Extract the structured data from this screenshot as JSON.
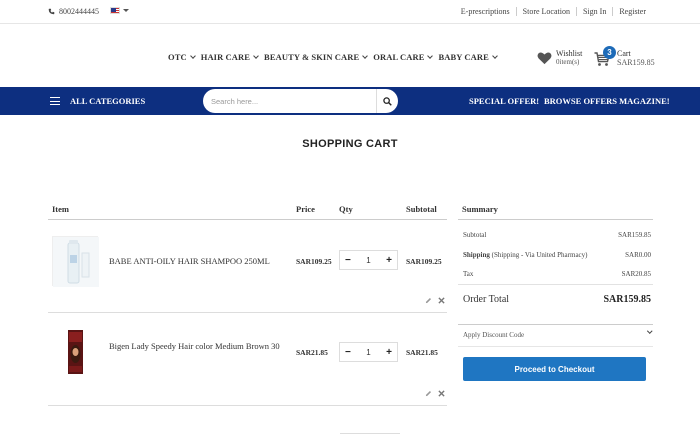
{
  "topbar": {
    "phone": "8002444445",
    "icons": {
      "phone": "phone-icon",
      "flag": "us-flag-icon"
    },
    "links": [
      "E-prescriptions",
      "Store Location",
      "Sign In",
      "Register"
    ]
  },
  "nav": {
    "items": [
      "OTC",
      "HAIR CARE",
      "BEAUTY & SKIN CARE",
      "ORAL CARE",
      "BABY CARE"
    ]
  },
  "wishlist": {
    "label": "Wishlist",
    "count": "0item(s)"
  },
  "cart": {
    "badge": "3",
    "label": "Cart",
    "amount": "SAR159.85"
  },
  "bluebar": {
    "all_categories": "ALL CATEGORIES",
    "search_placeholder": "Search here...",
    "special_offer": "SPECIAL OFFER!",
    "browse_offers": "BROWSE OFFERS MAGAZINE!"
  },
  "page": {
    "title": "SHOPPING CART"
  },
  "table": {
    "headers": {
      "item": "Item",
      "price": "Price",
      "qty": "Qty",
      "subtotal": "Subtotal"
    },
    "rows": [
      {
        "name": "BABE ANTI-OILY HAIR SHAMPOO 250ML",
        "price": "SAR109.25",
        "qty": "1",
        "subtotal": "SAR109.25"
      },
      {
        "name": "Bigen Lady Speedy Hair color Medium Brown 30",
        "price": "SAR21.85",
        "qty": "1",
        "subtotal": "SAR21.85"
      }
    ],
    "minus": "−",
    "plus": "+"
  },
  "summary": {
    "title": "Summary",
    "subtotal_label": "Subtotal",
    "subtotal_value": "SAR159.85",
    "shipping_label": "Shipping",
    "shipping_note": "(Shipping - Via United Pharmacy)",
    "shipping_value": "SAR0.00",
    "tax_label": "Tax",
    "tax_value": "SAR20.85",
    "order_total_label": "Order Total",
    "order_total_value": "SAR159.85",
    "discount_label": "Apply Discount Code",
    "checkout_label": "Proceed to Checkout"
  },
  "colors": {
    "brand_blue": "#0d2f80",
    "button_blue": "#1f76c2",
    "badge_blue": "#1e6bb8"
  }
}
